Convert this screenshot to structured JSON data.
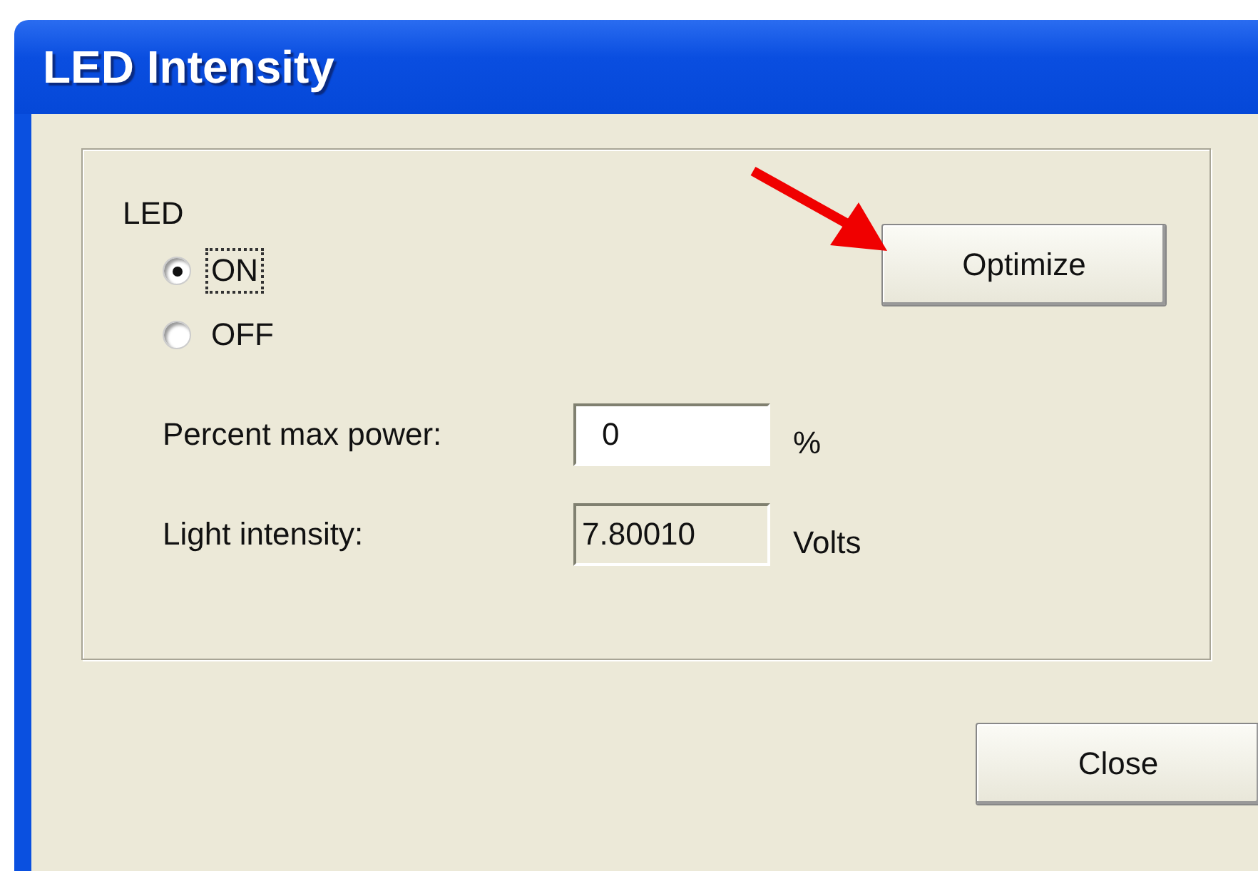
{
  "window": {
    "title": "LED Intensity"
  },
  "group": {
    "label": "LED",
    "radios": [
      {
        "label": "ON",
        "selected": true,
        "focused": true
      },
      {
        "label": "OFF",
        "selected": false,
        "focused": false
      }
    ],
    "action_button": "Optimize",
    "fields": [
      {
        "label": "Percent max power:",
        "value": "0",
        "unit": "%",
        "readonly": false
      },
      {
        "label": "Light intensity:",
        "value": "7.80010",
        "unit": "Volts",
        "readonly": true
      }
    ]
  },
  "buttons": [
    "Close"
  ]
}
